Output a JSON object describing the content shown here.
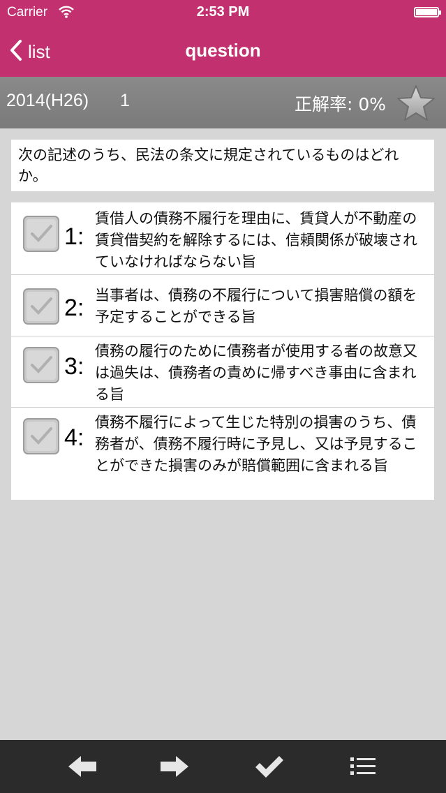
{
  "status_bar": {
    "carrier": "Carrier",
    "time": "2:53 PM",
    "wifi_icon": "wifi-icon",
    "battery_icon": "battery-icon"
  },
  "nav": {
    "back_label": "list",
    "title": "question",
    "color": "#c2306f"
  },
  "info": {
    "year": "2014(H26)",
    "question_number": "1",
    "accuracy": "正解率: 0%",
    "star_icon": "star-icon"
  },
  "question": {
    "text": "次の記述のうち、民法の条文に規定されているものはどれか。"
  },
  "choices": [
    {
      "number": "1:",
      "text": "賃借人の債務不履行を理由に、賃貸人が不動産の賃貸借契約を解除するには、信頼関係が破壊されていなければならない旨"
    },
    {
      "number": "2:",
      "text": "当事者は、債務の不履行について損害賠償の額を予定することができる旨"
    },
    {
      "number": "3:",
      "text": "債務の履行のために債務者が使用する者の故意又は過失は、債務者の責めに帰すべき事由に含まれる旨"
    },
    {
      "number": "4:",
      "text": "債務不履行によって生じた特別の損害のうち、債務者が、債務不履行時に予見し、又は予見することができた損害のみが賠償範囲に含まれる旨"
    }
  ],
  "toolbar": {
    "icons": [
      "arrow-left-icon",
      "arrow-right-icon",
      "checkmark-icon",
      "list-icon"
    ]
  }
}
